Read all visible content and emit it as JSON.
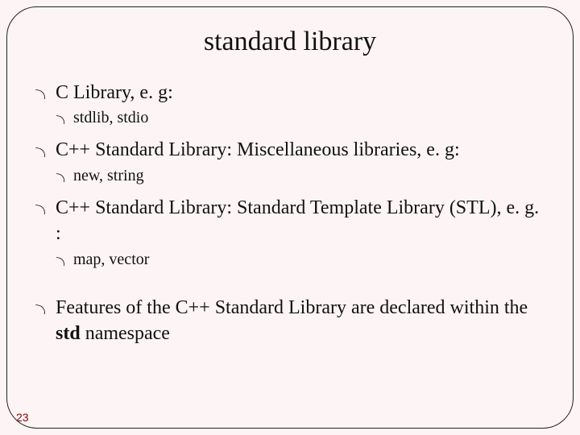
{
  "slide": {
    "title": "standard library",
    "bullets": {
      "b1": "C Library, e. g:",
      "b1_1": "stdlib, stdio",
      "b2": "C++ Standard Library: Miscellaneous libraries, e. g:",
      "b2_1": "new, string",
      "b3": "C++ Standard Library: Standard Template Library (STL), e. g. :",
      "b3_1": "map, vector",
      "b4_pre": "Features of the C++ Standard Library are declared within the ",
      "b4_bold": "std",
      "b4_post": " namespace"
    },
    "page_number": "23"
  }
}
